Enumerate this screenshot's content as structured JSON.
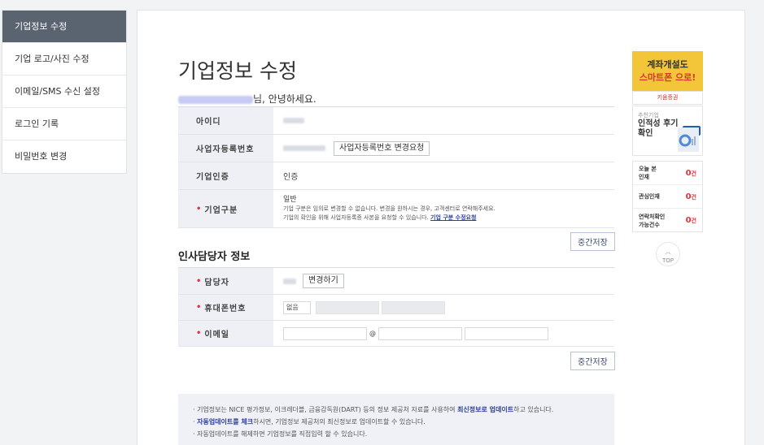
{
  "sidebar": {
    "items": [
      {
        "label": "기업정보 수정",
        "active": true
      },
      {
        "label": "기업 로고/사진 수정"
      },
      {
        "label": "이메일/SMS 수신 설정"
      },
      {
        "label": "로그인 기록"
      },
      {
        "label": "비밀번호 변경"
      }
    ]
  },
  "page": {
    "title": "기업정보 수정",
    "greeting_suffix": "님, 안녕하세요."
  },
  "company_info": {
    "rows": [
      {
        "label": "아이디"
      },
      {
        "label": "사업자등록번호",
        "button": "사업자등록번호 변경요청"
      },
      {
        "label": "기업인증",
        "value": "인증"
      },
      {
        "label": "기업구분",
        "value": "일반",
        "desc1": "기업 구분은 임의로 변경할 수 없습니다. 변경을 원하시는 경우, 고객센터로 연락해주세요.",
        "desc2": "기업의 확인을 위해 사업자등록증 사본을 요청할 수 있습니다.",
        "link": "기업 구분 수정요청"
      }
    ],
    "save_label": "중간저장"
  },
  "hr_section": {
    "title": "인사담당자 정보",
    "rows": [
      {
        "label": "담당자",
        "button": "변경하기"
      },
      {
        "label": "휴대폰번호",
        "select": "없음"
      },
      {
        "label": "이메일",
        "at": "@"
      }
    ],
    "save_label": "중간저장"
  },
  "notice": {
    "line1_a": "· 기업정보는 NICE 평가정보, 이크레더블, 금융감독원(DART) 등의 정보 제공처 자료를 사용하여 ",
    "line1_b": "최신정보로 업데이트",
    "line1_c": "하고 있습니다.",
    "line2_a": "· ",
    "line2_b": "자동업데이트를 체크",
    "line2_c": "하시면, 기업정보 제공처의 최신정보로 업데이트할 수 있습니다.",
    "line3": "· 자동업데이트를 해제하면 기업정보를 직접입력 할 수 있습니다."
  },
  "ad": {
    "line1": "계좌개설도",
    "line2": "스마트폰 으로!",
    "brand": "키움증권"
  },
  "card": {
    "small": "추천기업",
    "main1": "인적성 후기",
    "main2": "확인",
    "chat": "•••"
  },
  "stats": [
    {
      "label1": "오늘 본",
      "label2": "인재",
      "num": "0",
      "unit": "건"
    },
    {
      "label1": "관심인재",
      "label2": "",
      "num": "0",
      "unit": "건"
    },
    {
      "label1": "연락처확인",
      "label2": "가능건수",
      "num": "0",
      "unit": "건"
    }
  ],
  "top_button": {
    "arrow": "︿",
    "label": "TOP"
  },
  "colors": {
    "sidebar_active": "#5a6370",
    "accent_red": "#e0323e",
    "ad_yellow": "#f3c63a",
    "link_blue": "#2c3e9f"
  }
}
